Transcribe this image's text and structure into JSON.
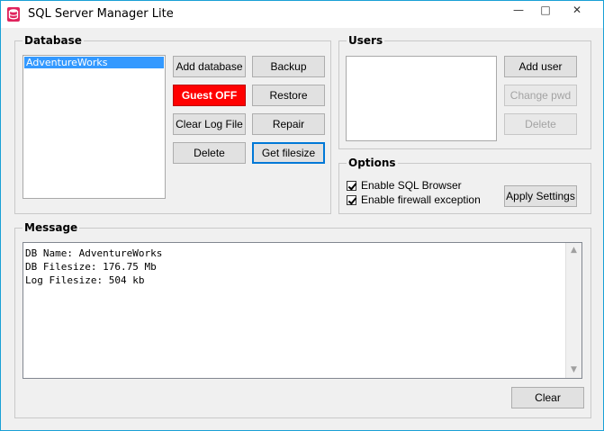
{
  "window": {
    "title": "SQL Server Manager Lite"
  },
  "database": {
    "legend": "Database",
    "items": [
      "AdventureWorks"
    ],
    "buttons": {
      "add_database": "Add database",
      "backup": "Backup",
      "guest_off": "Guest OFF",
      "restore": "Restore",
      "clear_log_file": "Clear Log File",
      "repair": "Repair",
      "delete": "Delete",
      "get_filesize": "Get filesize"
    }
  },
  "users": {
    "legend": "Users",
    "buttons": {
      "add_user": "Add user",
      "change_pwd": "Change pwd",
      "delete": "Delete"
    }
  },
  "options": {
    "legend": "Options",
    "enable_sql_browser": "Enable SQL Browser",
    "enable_firewall": "Enable firewall exception",
    "apply_settings": "Apply Settings"
  },
  "message": {
    "legend": "Message",
    "lines": [
      "DB Name: AdventureWorks",
      "DB Filesize: 176.75 Mb",
      "Log Filesize: 504 kb"
    ],
    "clear": "Clear"
  },
  "colors": {
    "guest_button": "#ff0000",
    "selection": "#3399ff"
  }
}
